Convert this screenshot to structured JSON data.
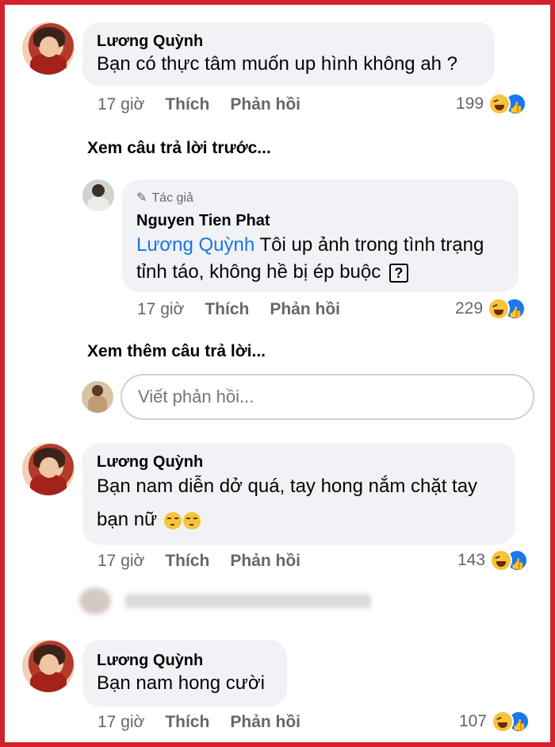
{
  "comments": [
    {
      "name": "Lương Quỳnh",
      "text": "Bạn có thực tâm muốn up hình không ah ?",
      "time": "17 giờ",
      "like_label": "Thích",
      "reply_label": "Phản hồi",
      "reaction_count": "199"
    },
    {
      "author_tag": "Tác giả",
      "name": "Nguyen Tien Phat",
      "mention": "Lương Quỳnh",
      "text": "Tôi up ảnh trong tình trạng tỉnh táo, không hề bị ép buộc",
      "unknown_glyph": "?",
      "time": "17 giờ",
      "like_label": "Thích",
      "reply_label": "Phản hồi",
      "reaction_count": "229"
    },
    {
      "name": "Lương Quỳnh",
      "text_line1": "Bạn nam diễn dở quá, tay hong nắm chặt tay",
      "text_line2": "bạn nữ",
      "time": "17 giờ",
      "like_label": "Thích",
      "reply_label": "Phản hồi",
      "reaction_count": "143"
    },
    {
      "name": "Lương Quỳnh",
      "text": "Bạn nam hong cười",
      "time": "17 giờ",
      "like_label": "Thích",
      "reply_label": "Phản hồi",
      "reaction_count": "107"
    }
  ],
  "see_previous_replies": "Xem câu trả lời trước...",
  "see_more_replies": "Xem thêm câu trả lời...",
  "reply_input": {
    "placeholder": "Viết phản hồi..."
  },
  "colors": {
    "frame": "#d1222d",
    "bubble": "#f0f2f5",
    "mention": "#1b74e4",
    "meta": "#65676b"
  }
}
